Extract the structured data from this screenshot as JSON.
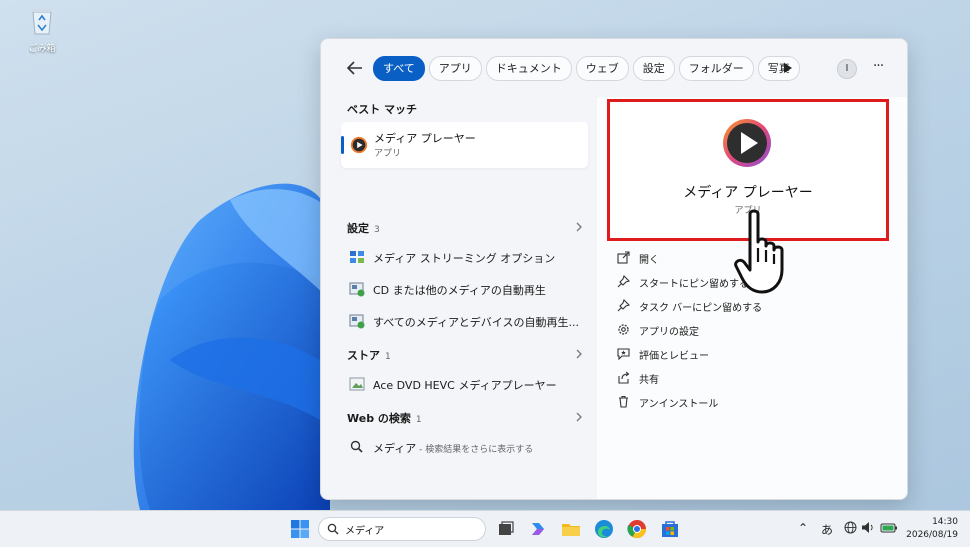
{
  "desktop": {
    "recycle_bin_label": "ごみ箱"
  },
  "toolbar": {
    "chips": [
      "すべて",
      "アプリ",
      "ドキュメント",
      "ウェブ",
      "設定",
      "フォルダー",
      "写真"
    ],
    "avatar_label": "I",
    "more_label": "···"
  },
  "results": {
    "best_match_title": "ベスト マッチ",
    "best_match": {
      "name": "メディア プレーヤー",
      "type": "アプリ"
    },
    "settings_title": "設定",
    "settings_count": "3",
    "settings_items": [
      "メディア ストリーミング オプション",
      "CD または他のメディアの自動再生",
      "すべてのメディアとデバイスの自動再生..."
    ],
    "store_title": "ストア",
    "store_count": "1",
    "store_items": [
      "Ace DVD HEVC メディアプレーヤー"
    ],
    "web_title": "Web の検索",
    "web_count": "1",
    "web_item": {
      "query": "メディア",
      "hint": " - 検索結果をさらに表示する"
    }
  },
  "preview": {
    "name": "メディア プレーヤー",
    "type": "アプリ",
    "actions": [
      "開く",
      "スタートにピン留めする",
      "タスク バーにピン留めする",
      "アプリの設定",
      "評価とレビュー",
      "共有",
      "アンインストール"
    ]
  },
  "taskbar": {
    "search_value": "メディア",
    "ime": "あ",
    "time": "14:30",
    "date": "2026/08/19"
  },
  "colors": {
    "accent": "#0a5fc4",
    "highlight_border": "#e01b1b"
  }
}
